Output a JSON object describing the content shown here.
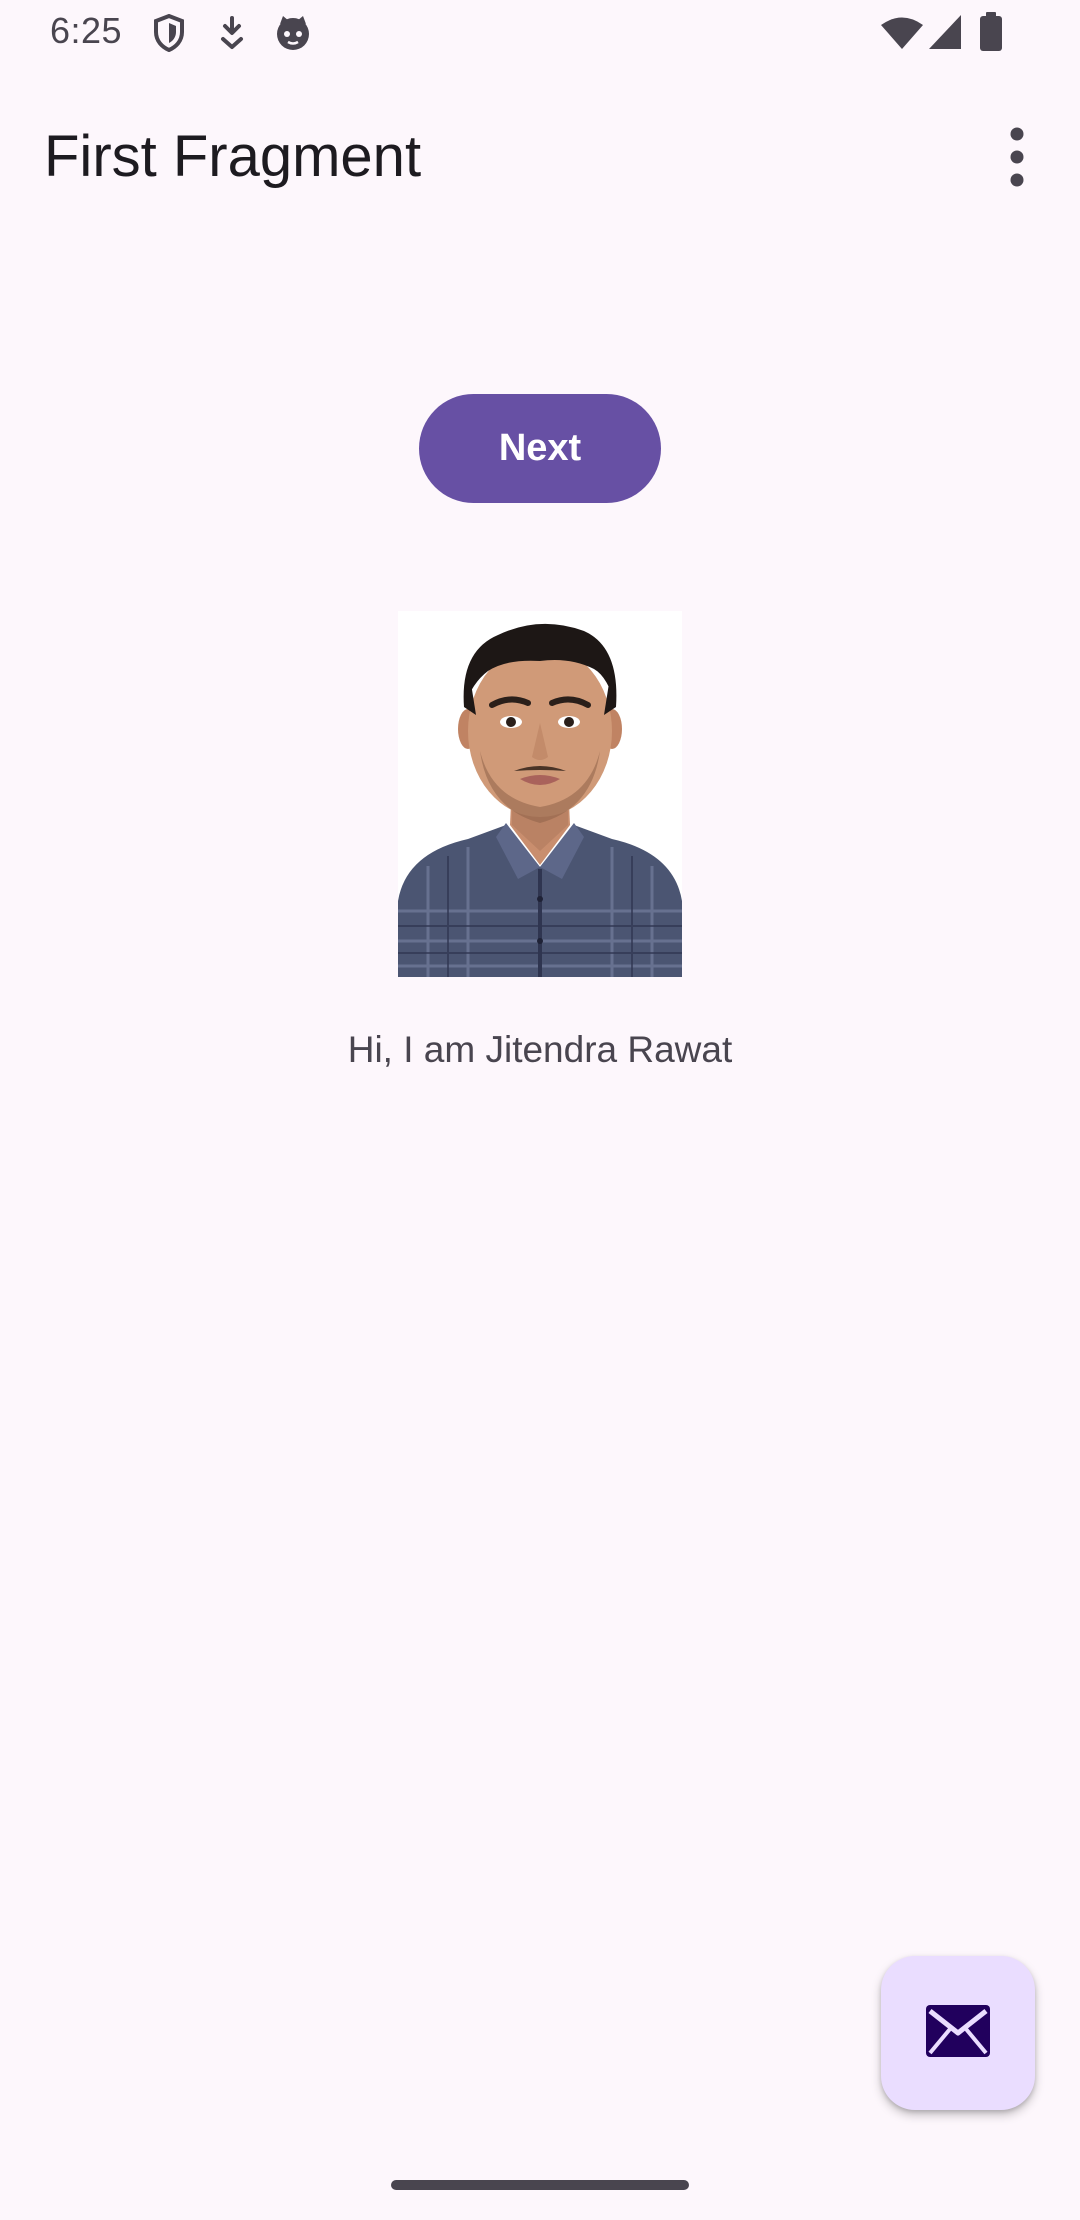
{
  "status_bar": {
    "time": "6:25",
    "left_icons": [
      "shield-icon",
      "download-icon",
      "cat-face-icon"
    ],
    "right_icons": [
      "wifi-icon",
      "cell-signal-icon",
      "battery-icon"
    ]
  },
  "app_bar": {
    "title": "First Fragment",
    "overflow_icon": "more-vert-icon"
  },
  "main": {
    "next_button_label": "Next",
    "profile_photo_icon": "profile-photo",
    "greeting": "Hi, I am Jitendra Rawat"
  },
  "fab": {
    "icon": "mail-icon"
  },
  "colors": {
    "background": "#fdf7fc",
    "primary": "#6750a4",
    "on_primary": "#ffffff",
    "fab_container": "#eaddff",
    "fab_icon": "#21005d",
    "text_primary": "#1d1b20",
    "text_secondary": "#49454f"
  }
}
